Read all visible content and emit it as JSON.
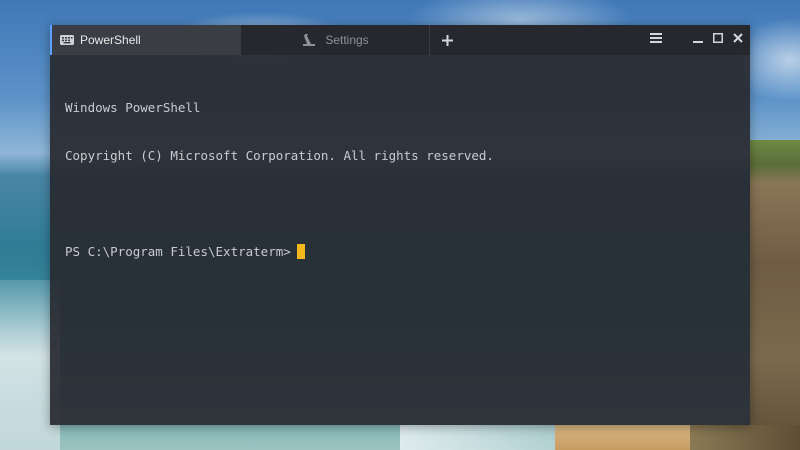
{
  "tabs": [
    {
      "label": "PowerShell",
      "icon": "keyboard-icon",
      "active": true
    },
    {
      "label": "Settings",
      "icon": "settings-wrench-icon",
      "active": false
    }
  ],
  "new_tab_icon": "plus-icon",
  "window_controls": [
    "hamburger-menu-icon",
    "minimize-icon",
    "maximize-icon",
    "close-icon"
  ],
  "terminal": {
    "lines": [
      "Windows PowerShell",
      "Copyright (C) Microsoft Corporation. All rights reserved.",
      ""
    ],
    "prompt": "PS C:\\Program Files\\Extraterm>"
  },
  "colors": {
    "accent": "#5da0ff",
    "cursor": "#f5b81a",
    "terminal_text": "#c8cbd0",
    "tabbar_bg": "#26282d"
  }
}
